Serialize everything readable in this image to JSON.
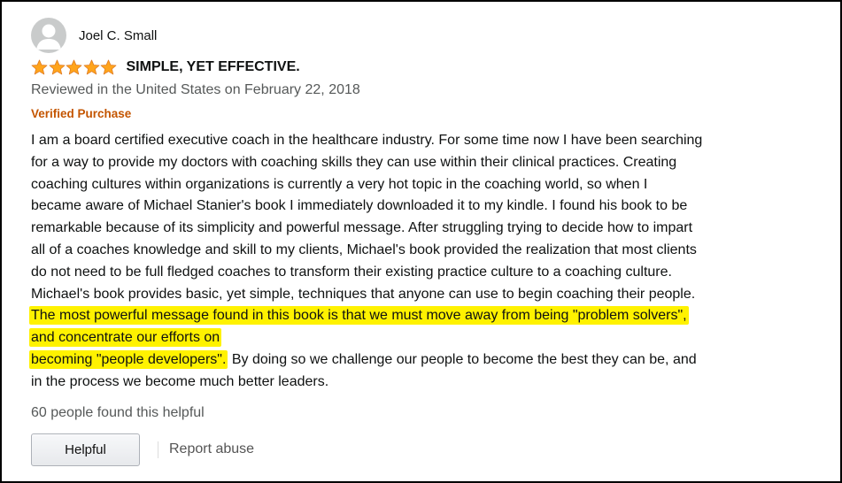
{
  "reviewer": {
    "name": "Joel C. Small"
  },
  "review": {
    "rating": 5,
    "rating_max": 5,
    "star_color": "#ffa41c",
    "title": "SIMPLE, YET EFFECTIVE.",
    "date_text": "Reviewed in the United States on February 22, 2018",
    "verified_label": "Verified Purchase",
    "highlight_color": "#fff200",
    "body_lines": [
      {
        "text": "I am a board certified executive coach in the healthcare industry. For some time now I have been searching"
      },
      {
        "text": "for a way to provide my doctors with coaching skills they can use within their clinical practices. Creating"
      },
      {
        "text": "coaching cultures within organizations is currently a very hot topic in the coaching world, so when I"
      },
      {
        "text": "became aware of Michael Stanier's book I immediately downloaded it to my kindle. I found his book to be"
      },
      {
        "text": "remarkable because of its simplicity and powerful message. After struggling trying to decide how to impart"
      },
      {
        "text": "all of a coaches knowledge and skill to my clients, Michael's book provided the realization that most clients"
      },
      {
        "text": "do not need to be full fledged coaches to transform their existing practice culture to a coaching culture."
      },
      {
        "text": "Michael's book provides basic, yet simple, techniques that anyone can use to begin coaching their people."
      },
      {
        "highlight": "The most powerful message found in this book is that we must move away from being \"problem solvers\","
      },
      {
        "highlight": "and concentrate our efforts on"
      },
      {
        "highlight": "becoming \"people developers\".",
        "text": " By doing so we challenge our people to become the best they can be, and"
      },
      {
        "text": "in the process we become much better leaders."
      }
    ]
  },
  "footer": {
    "helpful_count_text": "60 people found this helpful",
    "helpful_button_label": "Helpful",
    "report_abuse_label": "Report abuse"
  },
  "icons": {
    "avatar": "user-silhouette-icon",
    "star": "star-icon"
  }
}
